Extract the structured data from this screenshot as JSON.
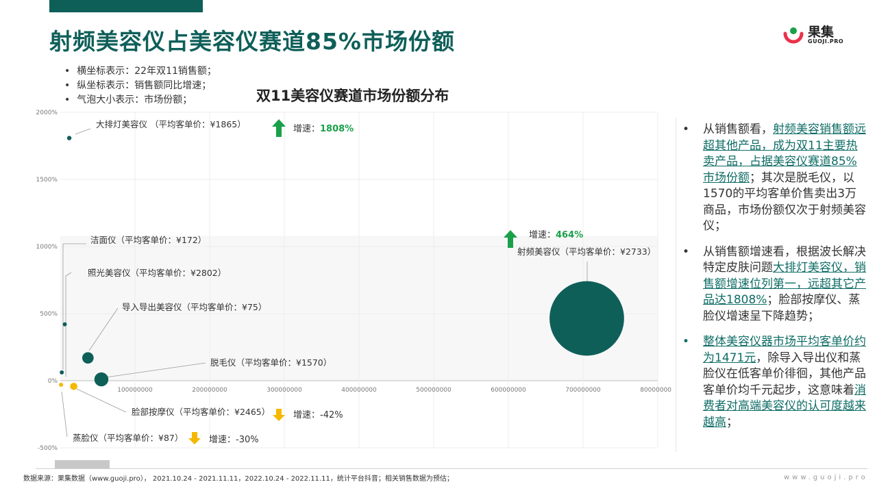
{
  "page": {
    "title": "射频美容仪占美容仪赛道85%市场份额",
    "brand_name": "果集",
    "brand_url": "GUOJI.PRO",
    "legend_notes": [
      "横坐标表示：22年双11销售额；",
      "纵坐标表示：销售额同比增速；",
      "气泡大小表示：市场份额；"
    ],
    "footer_source": "数据来源：果集数据（www.guoji.pro），  2021.10.24 - 2021.11.11，2022.10.24 - 2022.11.11，统计平台抖音；相关销售数据为预估；",
    "footer_url": "www.guoji.pro"
  },
  "colors": {
    "primary": "#0f5f59",
    "accent": "#f5b800",
    "up": "#1aa04a",
    "highlight_text": "#0f6d66"
  },
  "insights": [
    {
      "segments": [
        {
          "t": "从销售额看，",
          "hl": false
        },
        {
          "t": "射频美容销售额远超其他产品，成为双11主要热卖产品，占据美容仪赛道85%市场份额",
          "hl": true
        },
        {
          "t": "；其次是脱毛仪，以1570的平均客单价售卖出3万商品，市场份额仅次于射频美容仪；",
          "hl": false
        }
      ]
    },
    {
      "segments": [
        {
          "t": "从销售额增速看，根据波长解决特定皮肤问题",
          "hl": false
        },
        {
          "t": "大排灯美容仪，销售额增速位列第一，远超其它产品达1808%",
          "hl": true
        },
        {
          "t": "；脸部按摩仪、蒸脸仪增速呈下降趋势；",
          "hl": false
        }
      ]
    },
    {
      "segments": [
        {
          "t": "整体美容仪器市场平均客单价约为1471元",
          "hl": true
        },
        {
          "t": "，除导入导出仪和蒸脸仪在低客单价徘徊，其他产品客单价均千元起步，这意味着",
          "hl": false
        },
        {
          "t": "消费者对高端美容仪的认可度越来越高",
          "hl": true
        },
        {
          "t": "；",
          "hl": false
        }
      ]
    }
  ],
  "chart_data": {
    "type": "bubble",
    "title": "双11美容仪赛道市场份额分布",
    "xlabel": "",
    "ylabel": "",
    "xlim": [
      0,
      800000000
    ],
    "ylim": [
      -500,
      2000
    ],
    "x_ticks": [
      "100000000",
      "200000000",
      "300000000",
      "400000000",
      "500000000",
      "600000000",
      "700000000",
      "800000000"
    ],
    "y_ticks": [
      "-500%",
      "0%",
      "500%",
      "1000%",
      "1500%",
      "2000%"
    ],
    "grid": true,
    "points": [
      {
        "name": "大排灯美容仪",
        "label": "大排灯美容仪 （平均客单价：¥1865）",
        "x": 12000000,
        "y": 1808,
        "share": 0.3,
        "color": "#0f5f59"
      },
      {
        "name": "洁面仪",
        "label": "洁面仪（平均客单价：¥172）",
        "x": 2000000,
        "y": 62,
        "share": 0.05,
        "color": "#0f5f59"
      },
      {
        "name": "照光美容仪",
        "label": "照光美容仪（平均客单价：¥2802）",
        "x": 6000000,
        "y": 420,
        "share": 0.15,
        "color": "#0f5f59"
      },
      {
        "name": "导入导出美容仪",
        "label": "导入导出美容仪（平均客单价：¥75）",
        "x": 37000000,
        "y": 170,
        "share": 2,
        "color": "#0f5f59"
      },
      {
        "name": "脱毛仪",
        "label": "脱毛仪（平均客单价：¥1570）",
        "x": 55000000,
        "y": 10,
        "share": 3,
        "color": "#0f5f59"
      },
      {
        "name": "射频美容仪",
        "label": "射频美容仪（平均客单价：¥2733）",
        "x": 705000000,
        "y": 464,
        "share": 85,
        "color": "#0f5f59"
      },
      {
        "name": "脸部按摩仪",
        "label": "脸部按摩仪（平均客单价：¥2465）",
        "x": 18000000,
        "y": -42,
        "share": 0.8,
        "color": "#f5b800"
      },
      {
        "name": "蒸脸仪",
        "label": "蒸脸仪（平均客单价：¥87）",
        "x": 1000000,
        "y": -30,
        "share": 0.05,
        "color": "#f5b800"
      }
    ],
    "growth_callouts": [
      {
        "label": "增速：",
        "value": "1808%",
        "direction": "up"
      },
      {
        "label": "增速：",
        "value": "464%",
        "direction": "up"
      },
      {
        "label": "增速：",
        "value": "-42%",
        "direction": "down"
      },
      {
        "label": "增速：",
        "value": "-30%",
        "direction": "down"
      }
    ]
  }
}
